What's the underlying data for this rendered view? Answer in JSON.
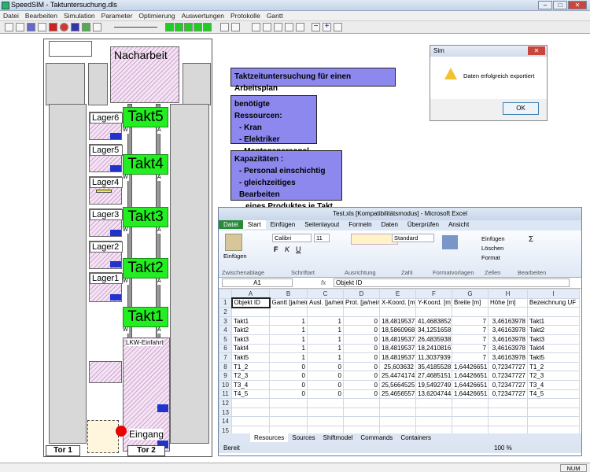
{
  "app": {
    "title": "SpeedSIM - Taktuntersuchung.dls"
  },
  "menu": [
    "Datei",
    "Bearbeiten",
    "Simulation",
    "Parameter",
    "Optimierung",
    "Auswertungen",
    "Protokolle",
    "Gantt"
  ],
  "layout": {
    "nacharbeit": "Nacharbeit",
    "takts": [
      "Takt5",
      "Takt4",
      "Takt3",
      "Takt2",
      "Takt1"
    ],
    "lagers": [
      "Lager6",
      "Lager5",
      "Lager4",
      "Lager3",
      "Lager2",
      "Lager1"
    ],
    "lkw": "LKW-Einfahrt",
    "eingang": "Eingang",
    "tor1": "Tor 1",
    "tor2": "Tor 2",
    "w": "W",
    "a": "A"
  },
  "info": {
    "title": "Taktzeituntersuchung  für einen Arbeitsplan",
    "resources_title": "benötigte Ressourcen:",
    "resources": [
      "- Kran",
      "- Elektriker",
      "- Montagepersonal"
    ],
    "capacity_title": "Kapazitäten :",
    "capacity": [
      "- Personal einschichtig",
      "- gleichzeitiges Bearbeiten",
      "eines Produktes je Takt"
    ]
  },
  "dialog": {
    "title": "Sim",
    "message": "Daten erfolgreich exportiert",
    "ok": "OK"
  },
  "excel": {
    "title": "Test.xls  [Kompatibilitätsmodus]  -  Microsoft Excel",
    "tabs": [
      "Datei",
      "Start",
      "Einfügen",
      "Seitenlayout",
      "Formeln",
      "Daten",
      "Überprüfen",
      "Ansicht"
    ],
    "font": "Calibri",
    "size": "11",
    "format": "Standard",
    "groups": [
      "Zwischenablage",
      "Schriftart",
      "Ausrichtung",
      "Zahl",
      "Formatvorlagen",
      "Zellen",
      "Bearbeiten"
    ],
    "paste": "Einfügen",
    "cells_buttons": [
      "Einfügen",
      "Löschen",
      "Format"
    ],
    "cellref": "A1",
    "formula": "Objekt ID",
    "columns": [
      "A",
      "B",
      "C",
      "D",
      "E",
      "F",
      "G",
      "H",
      "I"
    ],
    "header": [
      "Objekt ID",
      "Gantt [ja/nein]",
      "Ausl. [ja/nein]",
      "Prot. [ja/nein]",
      "X-Koord. [m]",
      "Y-Koord. [m]",
      "Breite [m]",
      "Höhe [m]",
      "Bezeichnung UF"
    ],
    "rows": [
      [
        "",
        "",
        "",
        "",
        "",
        "",
        "",
        "",
        ""
      ],
      [
        "Takt1",
        "1",
        "1",
        "0",
        "18,4819537",
        "41,4683852",
        "7",
        "3,46163978",
        "Takt1"
      ],
      [
        "Takt2",
        "1",
        "1",
        "0",
        "18,5860968",
        "34,1251658",
        "7",
        "3,46163978",
        "Takt2"
      ],
      [
        "Takt3",
        "1",
        "1",
        "0",
        "18,4819537",
        "26,4835938",
        "7",
        "3,46163978",
        "Takt3"
      ],
      [
        "Takt4",
        "1",
        "1",
        "0",
        "18,4819537",
        "18,2410816",
        "7",
        "3,46163978",
        "Takt4"
      ],
      [
        "Takt5",
        "1",
        "1",
        "0",
        "18,4819537",
        "11,3037939",
        "7",
        "3,46163978",
        "Takt5"
      ],
      [
        "T1_2",
        "0",
        "0",
        "0",
        "25,603632",
        "35,4185528",
        "1,64426651",
        "0,72347727",
        "T1_2"
      ],
      [
        "T2_3",
        "0",
        "0",
        "0",
        "25,4474174",
        "27,4685151",
        "1,64426651",
        "0,72347727",
        "T2_3"
      ],
      [
        "T3_4",
        "0",
        "0",
        "0",
        "25,5664525",
        "19,5492749",
        "1,64426651",
        "0,72347727",
        "T3_4"
      ],
      [
        "T4_5",
        "0",
        "0",
        "0",
        "25,4656557",
        "13,6204744",
        "1,64426651",
        "0,72347727",
        "T4_5"
      ],
      [
        "",
        "",
        "",
        "",
        "",
        "",
        "",
        "",
        ""
      ],
      [
        "",
        "",
        "",
        "",
        "",
        "",
        "",
        "",
        ""
      ],
      [
        "",
        "",
        "",
        "",
        "",
        "",
        "",
        "",
        ""
      ],
      [
        "",
        "",
        "",
        "",
        "",
        "",
        "",
        "",
        ""
      ],
      [
        "",
        "",
        "",
        "",
        "",
        "",
        "",
        "",
        ""
      ]
    ],
    "sheets": [
      "Resources",
      "Sources",
      "Shiftmodel",
      "Commands",
      "Containers"
    ],
    "status": "Bereit",
    "zoom": "100 %"
  },
  "status": {
    "num": "NUM"
  }
}
